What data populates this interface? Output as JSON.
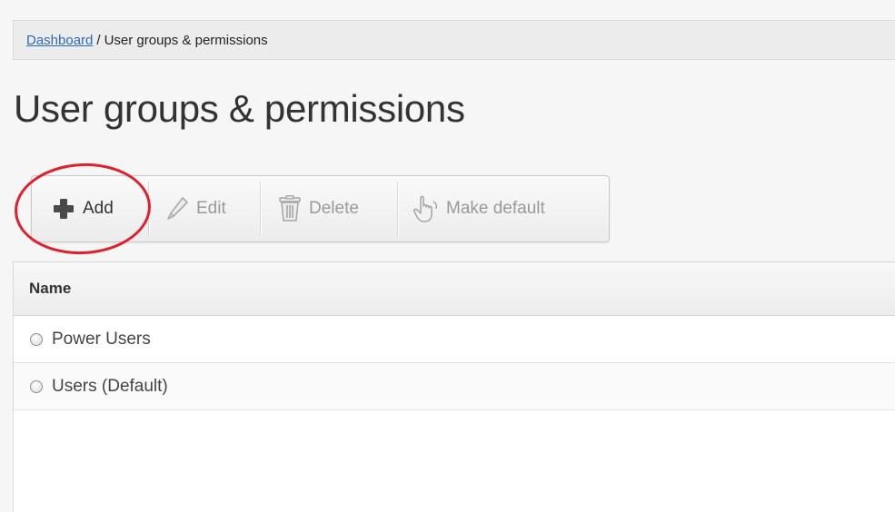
{
  "breadcrumb": {
    "link_label": "Dashboard",
    "separator": "/",
    "current": "User groups & permissions"
  },
  "page": {
    "title": "User groups & permissions"
  },
  "toolbar": {
    "add_label": "Add",
    "edit_label": "Edit",
    "delete_label": "Delete",
    "make_default_label": "Make default",
    "icons": {
      "add": "plus-icon",
      "edit": "pencil-icon",
      "delete": "trash-icon",
      "make_default": "hand-pointer-icon"
    }
  },
  "table": {
    "columns": [
      "Name"
    ],
    "rows": [
      {
        "name": "Power Users",
        "selected": false
      },
      {
        "name": "Users (Default)",
        "selected": false
      }
    ]
  },
  "colors": {
    "link": "#2a6bb8",
    "highlight": "#e0202a",
    "disabled_text": "#9a9a9a"
  }
}
